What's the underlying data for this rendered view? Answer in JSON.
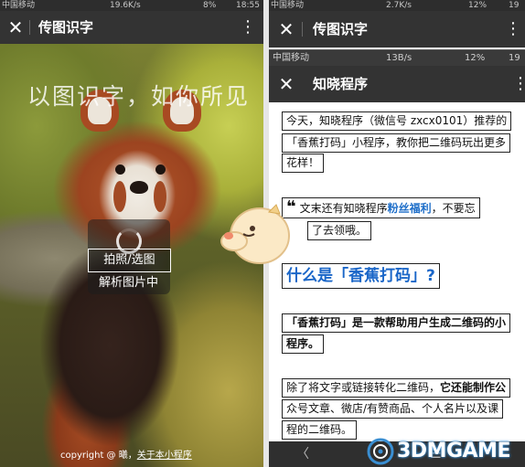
{
  "left": {
    "status_bar": {
      "carrier": "中国移动",
      "speed": "19.6K/s",
      "battery": "8%",
      "time": "18:55"
    },
    "title_bar": {
      "close_glyph": "✕",
      "title": "传图识字",
      "more_glyph": "⋮"
    },
    "slogan": "以图识字，如你所见",
    "pick_button_label": "拍照/选图",
    "loading_text": "解析图片中",
    "footer": {
      "copyright": "copyright @ 曦，",
      "about_link": "关于本小程序"
    }
  },
  "right": {
    "status_bar_top": {
      "carrier": "中国移动",
      "speed": "2.7K/s",
      "battery": "12%",
      "time": "19"
    },
    "title_bar_top": {
      "close_glyph": "✕",
      "title": "传图识字",
      "more_glyph": "⋮"
    },
    "status_bar_inner": {
      "carrier": "中国移动",
      "speed": "13B/s",
      "battery": "12%",
      "time": "19"
    },
    "title_bar_inner": {
      "close_glyph": "✕",
      "title": "知晓程序",
      "more_glyph": "⋮"
    },
    "article": {
      "intro_line1": "今天，知晓程序（微信号 zxcx0101）推荐的",
      "intro_line2": "「香蕉打码」小程序，教你把二维码玩出更多",
      "intro_line3": "花样！",
      "quote_glyph": "❝",
      "quote_line1_prefix": "文末还有知晓程序",
      "quote_highlight": "粉丝福利",
      "quote_line1_suffix": "，不要忘",
      "quote_line2": "了去领哦。",
      "heading": "什么是「香蕉打码」?",
      "def_line1": "「香蕉打码」是一款帮助用户生成二维码的小",
      "def_line2": "程序。",
      "body_line1_prefix": "除了将文字或链接转化二维码，",
      "body_line1_bold": "它还能制作公",
      "body_line2": "众号文章、微店/有赞商品、个人名片以及课",
      "body_line3": "程的二维码。"
    },
    "nav_bar": {
      "back_glyph": "〈",
      "home_glyph": "☰"
    }
  },
  "watermark": "3DMGAME",
  "colors": {
    "titlebar": "#333333",
    "statusbar": "#2d2d2d",
    "link_blue": "#1a66c8",
    "watermark_blue": "#3a8fd3"
  },
  "icons": [
    "close-icon",
    "more-icon",
    "spinner-icon",
    "quote-icon",
    "back-icon",
    "home-icon",
    "mascot",
    "watermark-logo"
  ]
}
